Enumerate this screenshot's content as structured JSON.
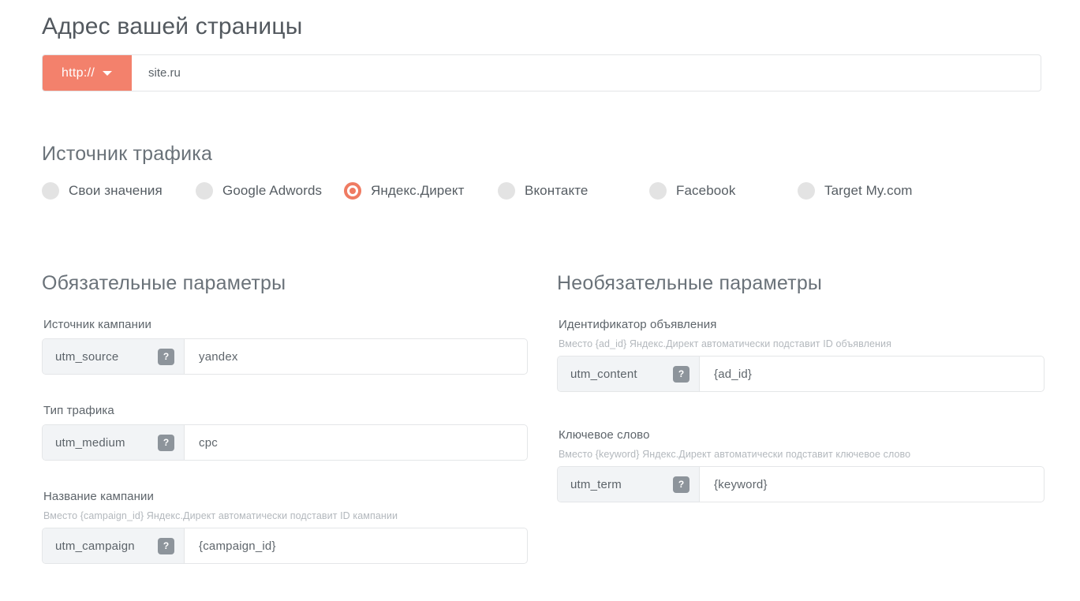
{
  "page": {
    "address_heading": "Адрес вашей страницы",
    "source_heading": "Источник трафика"
  },
  "url_field": {
    "scheme": "http://",
    "caret_icon": "chevron-down-icon",
    "value": "site.ru",
    "placeholder": "site.ru"
  },
  "traffic_sources": [
    {
      "label": "Свои значения",
      "selected": false
    },
    {
      "label": "Google Adwords",
      "selected": false
    },
    {
      "label": "Яндекс.Директ",
      "selected": true
    },
    {
      "label": "Вконтакте",
      "selected": false
    },
    {
      "label": "Facebook",
      "selected": false
    },
    {
      "label": "Target My.com",
      "selected": false
    }
  ],
  "required_section": {
    "heading": "Обязательные параметры",
    "fields": [
      {
        "label": "Источник кампании",
        "hint": "",
        "param": "utm_source",
        "help": "?",
        "value": "yandex"
      },
      {
        "label": "Тип трафика",
        "hint": "",
        "param": "utm_medium",
        "help": "?",
        "value": "cpc"
      },
      {
        "label": "Название кампании",
        "hint": "Вместо {campaign_id} Яндекс.Директ автоматически подставит ID кампании",
        "param": "utm_campaign",
        "help": "?",
        "value": "{campaign_id}"
      }
    ]
  },
  "optional_section": {
    "heading": "Необязательные параметры",
    "fields": [
      {
        "label": "Идентификатор объявления",
        "hint": "Вместо {ad_id} Яндекс.Директ автоматически подставит ID объявления",
        "param": "utm_content",
        "help": "?",
        "value": "{ad_id}"
      },
      {
        "label": "Ключевое слово",
        "hint": "Вместо {keyword} Яндекс.Директ автоматически подставит ключевое слово",
        "param": "utm_term",
        "help": "?",
        "value": "{keyword}"
      }
    ]
  },
  "colors": {
    "accent": "#f3816c",
    "accent_radio": "#ef7b62",
    "help_badge": "#8d949b",
    "prefix_bg": "#f2f4f6",
    "border": "#e4e6e8",
    "text": "#5d646a",
    "hint": "#b3b8bd"
  }
}
